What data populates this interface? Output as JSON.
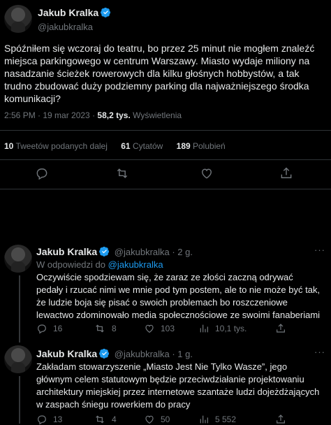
{
  "main_tweet": {
    "author_name": "Jakub Kralka",
    "author_handle": "@jakubkralka",
    "text": "Spóźniłem się wczoraj do teatru, bo przez 25 minut nie mogłem znaleźć miejsca parkingowego w centrum Warszawy. Miasto wydaje miliony na nasadzanie ścieżek rowerowych dla kilku głośnych hobbystów, a tak trudno zbudować duży podziemny parking dla najważniejszego środka komunikacji?",
    "time": "2:56 PM · 19 mar 2023 · ",
    "views_count": "58,2 tys.",
    "views_label": " Wyświetlenia",
    "retweets_count": "10",
    "retweets_label": " Tweetów podanych dalej",
    "quotes_count": "61",
    "quotes_label": " Cytatów",
    "likes_count": "189",
    "likes_label": " Polubień"
  },
  "replies": [
    {
      "author_name": "Jakub Kralka",
      "author_handle": "@jakubkralka",
      "age": " · 2 g.",
      "reply_to_prefix": "W odpowiedzi do ",
      "reply_to_handle": "@jakubkralka",
      "text": "Oczywiście spodziewam się, że zaraz ze złości zaczną odrywać pedały i rzucać nimi we mnie pod tym postem, ale to nie może być tak, że ludzie boja się pisać o swoich problemach bo roszczeniowe lewactwo zdominowało media społecznościowe ze swoimi fanaberiami",
      "replies": "16",
      "retweets": "8",
      "likes": "103",
      "views": "10,1 tys."
    },
    {
      "author_name": "Jakub Kralka",
      "author_handle": "@jakubkralka",
      "age": " · 1 g.",
      "text": "Zakładam stowarzyszenie „Miasto Jest Nie Tylko Wasze”, jego głównym celem statutowym będzie przeciwdziałanie projektowaniu architektury miejskiej przez internetowe szantaże ludzi dojeżdżających w zaspach śniegu rowerkiem do pracy",
      "replies": "13",
      "retweets": "4",
      "likes": "50",
      "views": "5 552"
    }
  ],
  "colors": {
    "background": "#000000",
    "text": "#e7e9ea",
    "muted": "#71767b",
    "link": "#1d9bf0",
    "verified": "#1d9bf0",
    "divider": "#2f3336"
  },
  "icons": [
    "verified-badge-icon",
    "reply-icon",
    "retweet-icon",
    "like-icon",
    "share-icon",
    "views-icon"
  ]
}
